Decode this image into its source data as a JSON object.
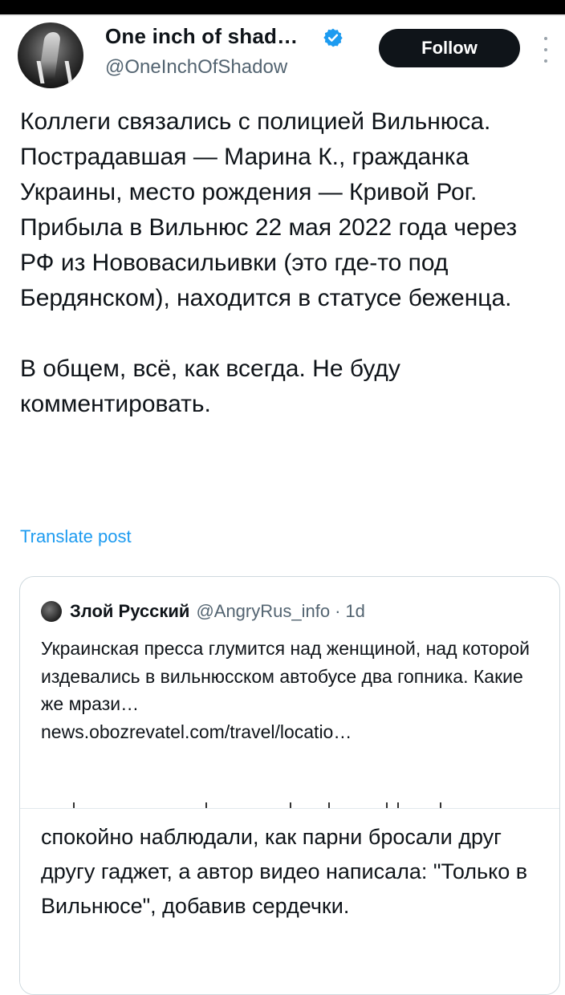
{
  "status_bar": {},
  "author": {
    "display_name": "One inch of shad…",
    "handle": "@OneInchOfShadow",
    "verified_icon": "verified-badge-icon",
    "avatar_icon": "avatar-image"
  },
  "follow_button": {
    "label": "Follow"
  },
  "more_icon": "more-vertical-icon",
  "post": {
    "paragraphs": [
      "Коллеги связались с полицией Вильнюса. Пострадавшая — Марина К., гражданка Украины, место рождения — Кривой Рог. Прибыла в Вильнюс 22 мая 2022 года через РФ из Нововасильивки (это где-то под Бердянском), находится в статусе беженца.",
      "В общем, всё, как всегда. Не буду комментировать."
    ],
    "translate_label": "Translate post"
  },
  "quote": {
    "name": "Злой Русский",
    "handle": "@AngryRus_info",
    "separator": "·",
    "time": "1d",
    "text": "Украинская пресса глумится над женщиной, над которой издевались в вильнюсском автобусе два гопника. Какие же мрази…",
    "link": "news.obozrevatel.com/travel/locatio…",
    "article_text": "спокойно наблюдали, как парни бросали друг другу гаджет, а автор видео написала: \"Только в Вильнюсе\", добавив сердечки."
  },
  "colors": {
    "accent": "#1d9bf0",
    "text": "#0f1419",
    "muted": "#536471",
    "button_bg": "#0f1419"
  }
}
